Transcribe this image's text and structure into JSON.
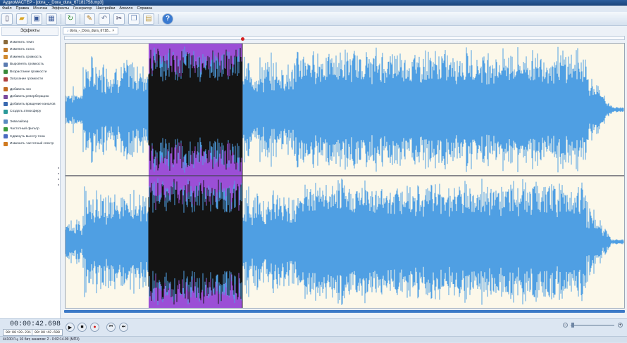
{
  "window": {
    "title": "АудиоМАСТЕР - [dora_-_Dora_dura_67181758.mp3]"
  },
  "menu": [
    "Файл",
    "Правка",
    "Монтаж",
    "Эффекты",
    "Генератор",
    "Настройки",
    "Аполло",
    "Справка"
  ],
  "toolbar": {
    "buttons": [
      {
        "name": "new-file",
        "icon": "file-icon"
      },
      {
        "name": "open-file",
        "icon": "folder-icon"
      },
      {
        "name": "save-file",
        "icon": "save-icon"
      },
      {
        "name": "save-as",
        "icon": "save-as-icon"
      },
      {
        "name": "refresh",
        "icon": "refresh-icon"
      },
      {
        "name": "select",
        "icon": "select-icon"
      },
      {
        "name": "undo",
        "icon": "undo-icon"
      },
      {
        "name": "cut",
        "icon": "scissors-icon"
      },
      {
        "name": "copy",
        "icon": "copy-icon"
      },
      {
        "name": "paste",
        "icon": "paste-icon"
      },
      {
        "name": "help",
        "icon": "help-icon"
      }
    ]
  },
  "sidebar": {
    "header": "Эффекты",
    "groups": [
      [
        {
          "label": "Изменить темп",
          "color": "#8a6a3a"
        },
        {
          "label": "Изменить голос",
          "color": "#c07a2a"
        },
        {
          "label": "Изменить громкость",
          "color": "#d18a30"
        },
        {
          "label": "Выровнять громкость",
          "color": "#5a7ab0"
        },
        {
          "label": "Возрастание громкости",
          "color": "#3a8a3a"
        },
        {
          "label": "Затухание громкости",
          "color": "#b04040"
        }
      ],
      [
        {
          "label": "Добавить эхо",
          "color": "#c06a20"
        },
        {
          "label": "Добавить реверберацию",
          "color": "#7a4aa0"
        },
        {
          "label": "Добавить вращение каналов",
          "color": "#3a6ab0"
        },
        {
          "label": "Создать атмосферу",
          "color": "#2a9a9a"
        }
      ],
      [
        {
          "label": "Эквалайзер",
          "color": "#5a8ac0"
        },
        {
          "label": "Частотный фильтр",
          "color": "#3a9a3a"
        },
        {
          "label": "Сдвинуть высоту тона",
          "color": "#4a6ac0"
        },
        {
          "label": "Изменить частотный спектр",
          "color": "#d07a20"
        }
      ]
    ]
  },
  "editor": {
    "tab_label": "dora_-_Dora_dura_6718...",
    "colors": {
      "wave": "#4f9fe3",
      "selection": "#9b4fd6",
      "background": "#fcf8ea",
      "marker": "#d62020"
    }
  },
  "transport": {
    "current_time": "00:00:42.698",
    "sel_start": "00:00:20.231",
    "sel_end": "00:00:42.698"
  },
  "statusbar": {
    "text": "44100 Гц, 16 бит, каналов: 2 - 0:02:14.99 (МП3)"
  }
}
